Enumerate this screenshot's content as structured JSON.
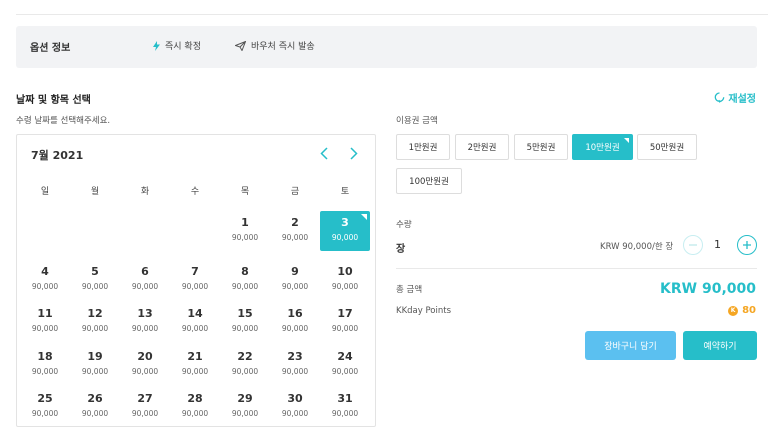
{
  "option": {
    "title": "옵션 정보",
    "features": [
      {
        "icon": "lightning-icon",
        "label": "즉시 확정"
      },
      {
        "icon": "paper-plane-icon",
        "label": "바우처 즉시 발송"
      }
    ]
  },
  "section": {
    "title": "날짜 및 항목 선택",
    "reset": "재설정",
    "date_hint": "수령 날짜를 선택해주세요."
  },
  "calendar": {
    "month": "7월 2021",
    "weekdays": [
      "일",
      "월",
      "화",
      "수",
      "목",
      "금",
      "토"
    ],
    "selected_day": "3",
    "days": [
      {
        "d": "1",
        "p": "90,000"
      },
      {
        "d": "2",
        "p": "90,000"
      },
      {
        "d": "3",
        "p": "90,000"
      },
      {
        "d": "4",
        "p": "90,000"
      },
      {
        "d": "5",
        "p": "90,000"
      },
      {
        "d": "6",
        "p": "90,000"
      },
      {
        "d": "7",
        "p": "90,000"
      },
      {
        "d": "8",
        "p": "90,000"
      },
      {
        "d": "9",
        "p": "90,000"
      },
      {
        "d": "10",
        "p": "90,000"
      },
      {
        "d": "11",
        "p": "90,000"
      },
      {
        "d": "12",
        "p": "90,000"
      },
      {
        "d": "13",
        "p": "90,000"
      },
      {
        "d": "14",
        "p": "90,000"
      },
      {
        "d": "15",
        "p": "90,000"
      },
      {
        "d": "16",
        "p": "90,000"
      },
      {
        "d": "17",
        "p": "90,000"
      },
      {
        "d": "18",
        "p": "90,000"
      },
      {
        "d": "19",
        "p": "90,000"
      },
      {
        "d": "20",
        "p": "90,000"
      },
      {
        "d": "21",
        "p": "90,000"
      },
      {
        "d": "22",
        "p": "90,000"
      },
      {
        "d": "23",
        "p": "90,000"
      },
      {
        "d": "24",
        "p": "90,000"
      },
      {
        "d": "25",
        "p": "90,000"
      },
      {
        "d": "26",
        "p": "90,000"
      },
      {
        "d": "27",
        "p": "90,000"
      },
      {
        "d": "28",
        "p": "90,000"
      },
      {
        "d": "29",
        "p": "90,000"
      },
      {
        "d": "30",
        "p": "90,000"
      },
      {
        "d": "31",
        "p": "90,000"
      }
    ]
  },
  "ticket": {
    "label": "이용권 금액",
    "selected": "10만원권",
    "options": [
      "1만원권",
      "2만원권",
      "5만원권",
      "10만원권",
      "50만원권",
      "100만원권"
    ]
  },
  "quantity": {
    "label": "수량",
    "item_name": "장",
    "unit_price": "KRW 90,000/한 장",
    "value": "1"
  },
  "total": {
    "label": "총 금액",
    "value": "KRW 90,000"
  },
  "points": {
    "label": "KKday Points",
    "value": "80",
    "coin_glyph": "K"
  },
  "actions": {
    "cart": "장바구니 담기",
    "book": "예약하기"
  },
  "colors": {
    "accent": "#26bec9",
    "cart_button": "#5bc0f0",
    "points": "#f5a623"
  }
}
